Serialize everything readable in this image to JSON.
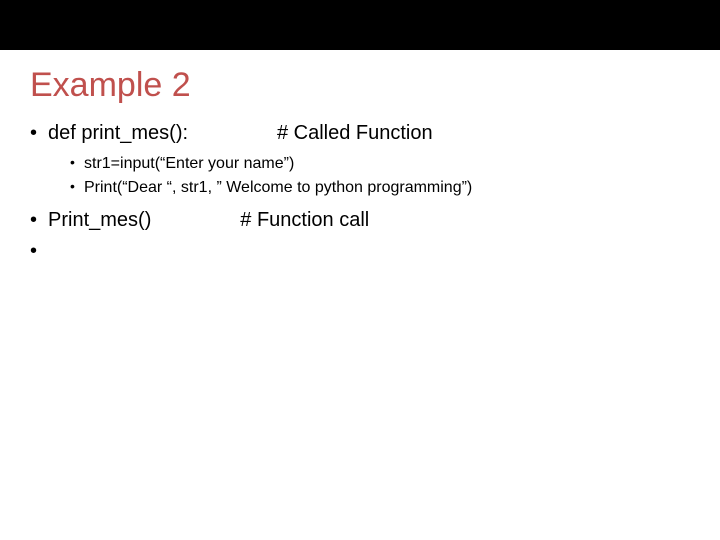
{
  "title": "Example 2",
  "bullets": {
    "line1_left": "def print_mes():",
    "line1_right": "# Called Function",
    "sub1": "str1=input(“Enter your name”)",
    "sub2": "Print(“Dear “, str1, ” Welcome to python programming”)",
    "line2_left": "Print_mes()",
    "line2_right": "# Function call",
    "line3": ""
  }
}
